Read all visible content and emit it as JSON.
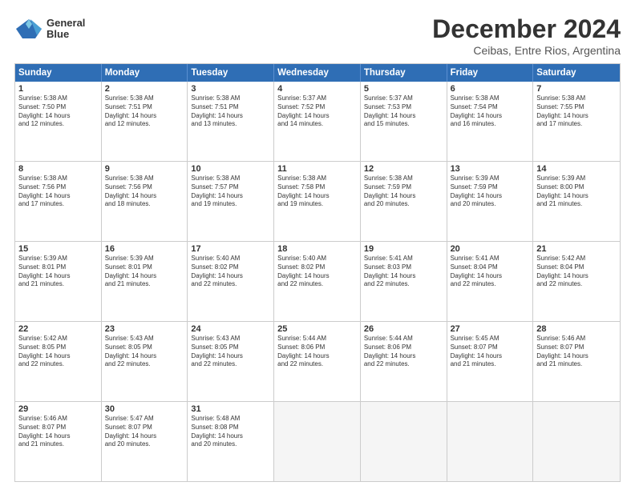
{
  "logo": {
    "line1": "General",
    "line2": "Blue"
  },
  "title": "December 2024",
  "subtitle": "Ceibas, Entre Rios, Argentina",
  "header_days": [
    "Sunday",
    "Monday",
    "Tuesday",
    "Wednesday",
    "Thursday",
    "Friday",
    "Saturday"
  ],
  "weeks": [
    [
      {
        "day": "1",
        "lines": [
          "Sunrise: 5:38 AM",
          "Sunset: 7:50 PM",
          "Daylight: 14 hours",
          "and 12 minutes."
        ]
      },
      {
        "day": "2",
        "lines": [
          "Sunrise: 5:38 AM",
          "Sunset: 7:51 PM",
          "Daylight: 14 hours",
          "and 12 minutes."
        ]
      },
      {
        "day": "3",
        "lines": [
          "Sunrise: 5:38 AM",
          "Sunset: 7:51 PM",
          "Daylight: 14 hours",
          "and 13 minutes."
        ]
      },
      {
        "day": "4",
        "lines": [
          "Sunrise: 5:37 AM",
          "Sunset: 7:52 PM",
          "Daylight: 14 hours",
          "and 14 minutes."
        ]
      },
      {
        "day": "5",
        "lines": [
          "Sunrise: 5:37 AM",
          "Sunset: 7:53 PM",
          "Daylight: 14 hours",
          "and 15 minutes."
        ]
      },
      {
        "day": "6",
        "lines": [
          "Sunrise: 5:38 AM",
          "Sunset: 7:54 PM",
          "Daylight: 14 hours",
          "and 16 minutes."
        ]
      },
      {
        "day": "7",
        "lines": [
          "Sunrise: 5:38 AM",
          "Sunset: 7:55 PM",
          "Daylight: 14 hours",
          "and 17 minutes."
        ]
      }
    ],
    [
      {
        "day": "8",
        "lines": [
          "Sunrise: 5:38 AM",
          "Sunset: 7:56 PM",
          "Daylight: 14 hours",
          "and 17 minutes."
        ]
      },
      {
        "day": "9",
        "lines": [
          "Sunrise: 5:38 AM",
          "Sunset: 7:56 PM",
          "Daylight: 14 hours",
          "and 18 minutes."
        ]
      },
      {
        "day": "10",
        "lines": [
          "Sunrise: 5:38 AM",
          "Sunset: 7:57 PM",
          "Daylight: 14 hours",
          "and 19 minutes."
        ]
      },
      {
        "day": "11",
        "lines": [
          "Sunrise: 5:38 AM",
          "Sunset: 7:58 PM",
          "Daylight: 14 hours",
          "and 19 minutes."
        ]
      },
      {
        "day": "12",
        "lines": [
          "Sunrise: 5:38 AM",
          "Sunset: 7:59 PM",
          "Daylight: 14 hours",
          "and 20 minutes."
        ]
      },
      {
        "day": "13",
        "lines": [
          "Sunrise: 5:39 AM",
          "Sunset: 7:59 PM",
          "Daylight: 14 hours",
          "and 20 minutes."
        ]
      },
      {
        "day": "14",
        "lines": [
          "Sunrise: 5:39 AM",
          "Sunset: 8:00 PM",
          "Daylight: 14 hours",
          "and 21 minutes."
        ]
      }
    ],
    [
      {
        "day": "15",
        "lines": [
          "Sunrise: 5:39 AM",
          "Sunset: 8:01 PM",
          "Daylight: 14 hours",
          "and 21 minutes."
        ]
      },
      {
        "day": "16",
        "lines": [
          "Sunrise: 5:39 AM",
          "Sunset: 8:01 PM",
          "Daylight: 14 hours",
          "and 21 minutes."
        ]
      },
      {
        "day": "17",
        "lines": [
          "Sunrise: 5:40 AM",
          "Sunset: 8:02 PM",
          "Daylight: 14 hours",
          "and 22 minutes."
        ]
      },
      {
        "day": "18",
        "lines": [
          "Sunrise: 5:40 AM",
          "Sunset: 8:02 PM",
          "Daylight: 14 hours",
          "and 22 minutes."
        ]
      },
      {
        "day": "19",
        "lines": [
          "Sunrise: 5:41 AM",
          "Sunset: 8:03 PM",
          "Daylight: 14 hours",
          "and 22 minutes."
        ]
      },
      {
        "day": "20",
        "lines": [
          "Sunrise: 5:41 AM",
          "Sunset: 8:04 PM",
          "Daylight: 14 hours",
          "and 22 minutes."
        ]
      },
      {
        "day": "21",
        "lines": [
          "Sunrise: 5:42 AM",
          "Sunset: 8:04 PM",
          "Daylight: 14 hours",
          "and 22 minutes."
        ]
      }
    ],
    [
      {
        "day": "22",
        "lines": [
          "Sunrise: 5:42 AM",
          "Sunset: 8:05 PM",
          "Daylight: 14 hours",
          "and 22 minutes."
        ]
      },
      {
        "day": "23",
        "lines": [
          "Sunrise: 5:43 AM",
          "Sunset: 8:05 PM",
          "Daylight: 14 hours",
          "and 22 minutes."
        ]
      },
      {
        "day": "24",
        "lines": [
          "Sunrise: 5:43 AM",
          "Sunset: 8:05 PM",
          "Daylight: 14 hours",
          "and 22 minutes."
        ]
      },
      {
        "day": "25",
        "lines": [
          "Sunrise: 5:44 AM",
          "Sunset: 8:06 PM",
          "Daylight: 14 hours",
          "and 22 minutes."
        ]
      },
      {
        "day": "26",
        "lines": [
          "Sunrise: 5:44 AM",
          "Sunset: 8:06 PM",
          "Daylight: 14 hours",
          "and 22 minutes."
        ]
      },
      {
        "day": "27",
        "lines": [
          "Sunrise: 5:45 AM",
          "Sunset: 8:07 PM",
          "Daylight: 14 hours",
          "and 21 minutes."
        ]
      },
      {
        "day": "28",
        "lines": [
          "Sunrise: 5:46 AM",
          "Sunset: 8:07 PM",
          "Daylight: 14 hours",
          "and 21 minutes."
        ]
      }
    ],
    [
      {
        "day": "29",
        "lines": [
          "Sunrise: 5:46 AM",
          "Sunset: 8:07 PM",
          "Daylight: 14 hours",
          "and 21 minutes."
        ]
      },
      {
        "day": "30",
        "lines": [
          "Sunrise: 5:47 AM",
          "Sunset: 8:07 PM",
          "Daylight: 14 hours",
          "and 20 minutes."
        ]
      },
      {
        "day": "31",
        "lines": [
          "Sunrise: 5:48 AM",
          "Sunset: 8:08 PM",
          "Daylight: 14 hours",
          "and 20 minutes."
        ]
      },
      {
        "day": "",
        "lines": []
      },
      {
        "day": "",
        "lines": []
      },
      {
        "day": "",
        "lines": []
      },
      {
        "day": "",
        "lines": []
      }
    ]
  ]
}
